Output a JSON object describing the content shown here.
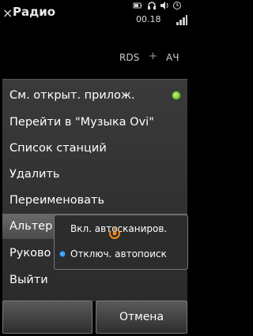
{
  "header": {
    "close_glyph": "×",
    "title": "Радио",
    "clock": "00.18"
  },
  "status_icons": [
    "battery-icon",
    "headset-icon",
    "speaker-icon",
    "clock-icon",
    "signal-icon"
  ],
  "radio": {
    "rds_label": "RDS",
    "plus_glyph": "+",
    "ach_label": "АЧ"
  },
  "menu": {
    "items": [
      {
        "label": "См. открыт. прилож.",
        "active_indicator": true
      },
      {
        "label": "Перейти в \"Музыка Ovi\""
      },
      {
        "label": "Список станций"
      },
      {
        "label": "Удалить"
      },
      {
        "label": "Переименовать"
      },
      {
        "label": "Альтер"
      },
      {
        "label": "Руково"
      },
      {
        "label": "Выйти"
      }
    ]
  },
  "submenu": {
    "items": [
      {
        "label": "Вкл. автосканиров.",
        "selected": false
      },
      {
        "label": "Отключ. автопоиск",
        "selected": true
      }
    ]
  },
  "softkeys": {
    "left": "",
    "right": "Отмена"
  },
  "colors": {
    "accent_green": "#5ea820",
    "selection_blue": "#4aa8ff",
    "busy_orange": "#f08a1c"
  }
}
